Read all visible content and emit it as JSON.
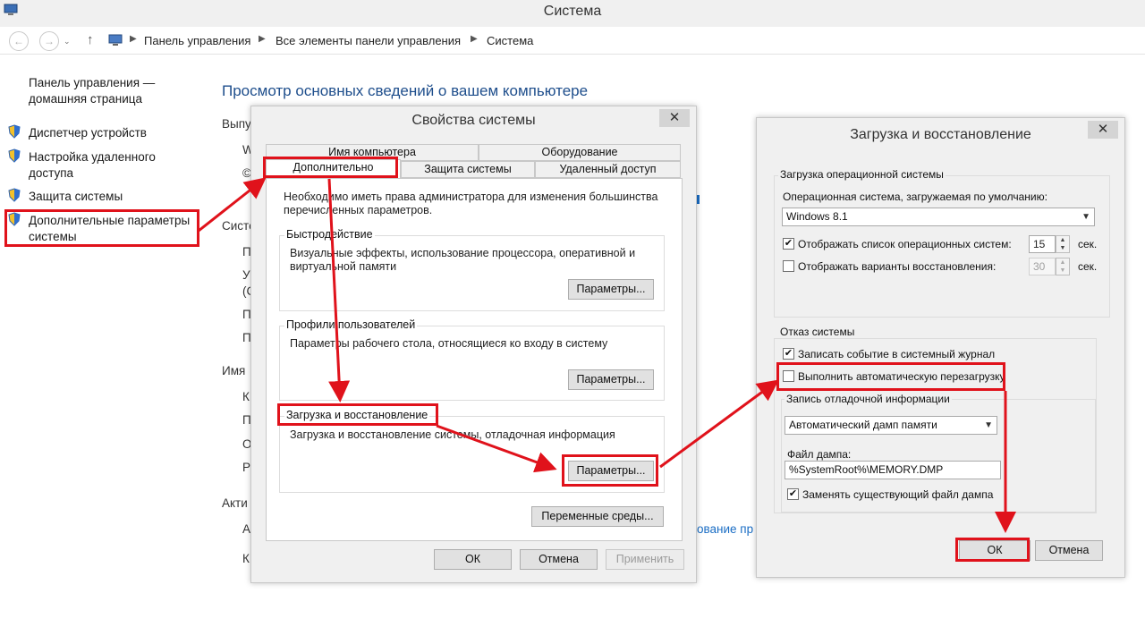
{
  "window": {
    "title": "Система"
  },
  "address": {
    "crumbs": [
      "Панель управления",
      "Все элементы панели управления",
      "Система"
    ]
  },
  "left_panel": {
    "home_link": [
      "Панель управления —",
      "домашняя страница"
    ],
    "links": [
      [
        "Диспетчер устройств"
      ],
      [
        "Настройка удаленного",
        "доступа"
      ],
      [
        "Защита системы"
      ],
      [
        "Дополнительные параметры",
        "системы"
      ]
    ]
  },
  "main": {
    "heading": "Просмотр основных сведений о вашем компьютере",
    "partial": [
      "Выпу",
      "W",
      "©",
      "Систе",
      "П",
      "У",
      "(С",
      "П",
      "П",
      "Имя",
      "К",
      "П",
      "О",
      "Р",
      "Акти",
      "А",
      "К"
    ],
    "partial_links": [
      "ование пр"
    ]
  },
  "sysprops": {
    "title": "Свойства системы",
    "close": "✕",
    "tabs_top": [
      "Имя компьютера",
      "Оборудование"
    ],
    "tabs_bottom": [
      "Дополнительно",
      "Защита системы",
      "Удаленный доступ"
    ],
    "admin_note": [
      "Необходимо иметь права администратора для изменения большинства",
      "перечисленных параметров."
    ],
    "perf": {
      "label": "Быстродействие",
      "desc": [
        "Визуальные эффекты, использование процессора, оперативной и",
        "виртуальной памяти"
      ],
      "button": "Параметры..."
    },
    "profiles": {
      "label": "Профили пользователей",
      "desc": "Параметры рабочего стола, относящиеся ко входу в систему",
      "button": "Параметры..."
    },
    "startup": {
      "label": "Загрузка и восстановление",
      "desc": "Загрузка и восстановление системы, отладочная информация",
      "button": "Параметры..."
    },
    "env_button": "Переменные среды...",
    "ok": "ОК",
    "cancel": "Отмена",
    "apply": "Применить"
  },
  "startup_dialog": {
    "title": "Загрузка и восстановление",
    "close": "✕",
    "os_group": "Загрузка операционной системы",
    "default_os_label": "Операционная система, загружаемая по умолчанию:",
    "default_os_value": "Windows 8.1",
    "show_list": {
      "label": "Отображать список операционных систем:",
      "checked": true,
      "value": "15",
      "unit": "сек."
    },
    "show_recovery": {
      "label": "Отображать варианты восстановления:",
      "checked": false,
      "value": "30",
      "unit": "сек."
    },
    "failure_group": "Отказ системы",
    "write_event": {
      "label": "Записать событие в системный журнал",
      "checked": true
    },
    "auto_restart": {
      "label": "Выполнить автоматическую перезагрузку",
      "checked": false
    },
    "debug_group": "Запись отладочной информации",
    "dump_type": "Автоматический дамп памяти",
    "dump_file_label": "Файл дампа:",
    "dump_file": "%SystemRoot%\\MEMORY.DMP",
    "overwrite": {
      "label": "Заменять существующий файл дампа",
      "checked": true
    },
    "ok": "ОК",
    "cancel": "Отмена"
  },
  "colors": {
    "highlight": "#e0121b",
    "heading": "#1e4e8c",
    "link": "#1a6dc4"
  }
}
